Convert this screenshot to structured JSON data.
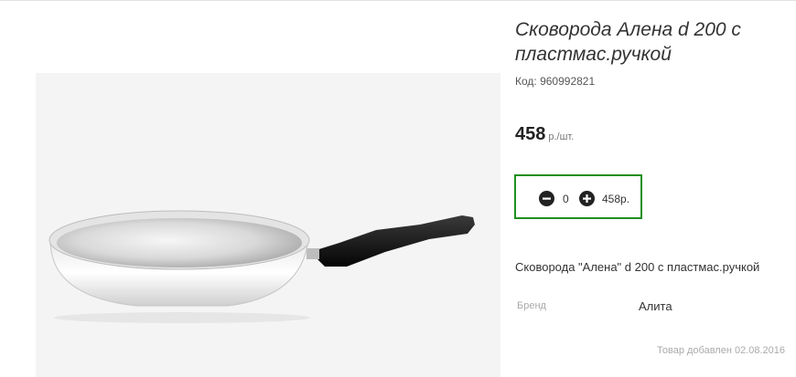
{
  "product": {
    "title": "Сковорода Алена d 200 с пластмас.ручкой",
    "sku": "Код: 960992821",
    "price_value": "458",
    "price_unit": "р./шт.",
    "description": "Сковорода \"Алена\" d 200 с пластмас.ручкой",
    "image_icon": "frying-pan-image"
  },
  "cart": {
    "quantity": "0",
    "total": "458р.",
    "minus_icon": "minus-circle-icon",
    "plus_icon": "plus-circle-icon",
    "border_color": "#1f8f1f"
  },
  "attributes": {
    "brand_label": "Бренд",
    "brand_value": "Алита"
  },
  "footer": {
    "added_text": "Товар добавлен 02.08.2016"
  }
}
